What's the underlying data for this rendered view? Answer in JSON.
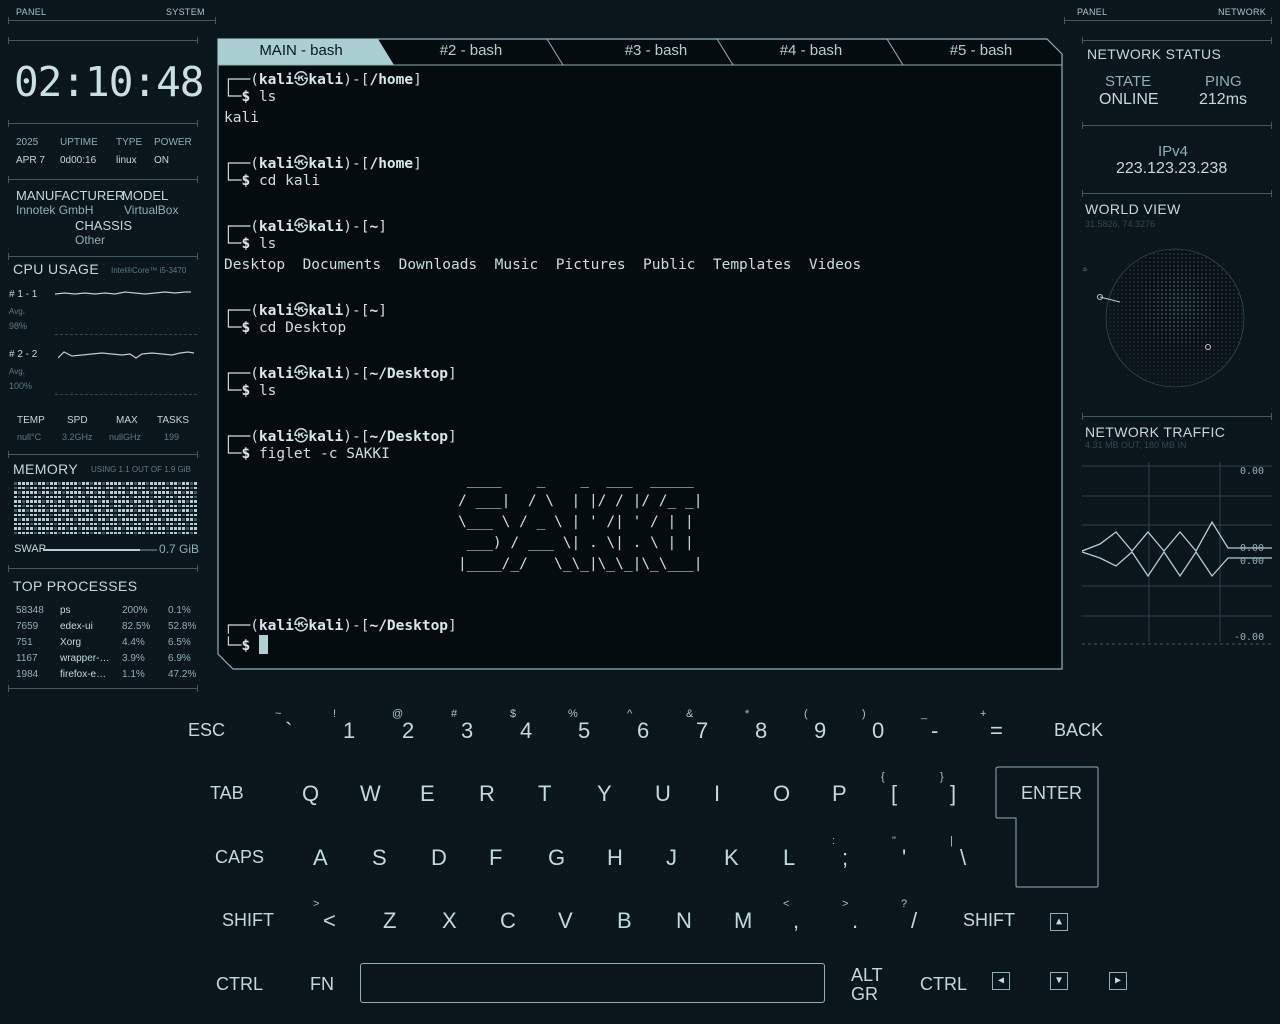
{
  "left_panel": {
    "header_left": "PANEL",
    "header_right": "SYSTEM",
    "clock": "02:10:48",
    "info_labels": [
      "2025",
      "UPTIME",
      "TYPE",
      "POWER"
    ],
    "info_values": [
      "APR 7",
      "0d00:16",
      "linux",
      "ON"
    ],
    "hw_labels": [
      "MANUFACTURER",
      "MODEL"
    ],
    "hw_values": [
      "Innotek GmbH",
      "VirtualBox"
    ],
    "chassis_label": "CHASSIS",
    "chassis_value": "Other",
    "cpu_title": "CPU USAGE",
    "cpu_model": "Intel®Core™ i5-3470",
    "cpu_groups": [
      {
        "label": "# 1 - 1",
        "avg_label": "Avg.",
        "avg": "98%"
      },
      {
        "label": "# 2 - 2",
        "avg_label": "Avg.",
        "avg": "100%"
      }
    ],
    "stats_labels": [
      "TEMP",
      "SPD",
      "MAX",
      "TASKS"
    ],
    "stats_values": [
      "null°C",
      "3.2GHz",
      "nullGHz",
      "199"
    ],
    "memory_title": "MEMORY",
    "memory_usage": "USING 1.1 OUT OF 1.9 GiB",
    "swap_label": "SWAP",
    "swap_value": "0.7 GiB",
    "swap_fraction": 0.85,
    "processes_title": "TOP PROCESSES",
    "processes": [
      {
        "pid": "58348",
        "name": "ps",
        "cpu": "200%",
        "mem": "0.1%"
      },
      {
        "pid": "7659",
        "name": "edex-ui",
        "cpu": "82.5%",
        "mem": "52.8%"
      },
      {
        "pid": "751",
        "name": "Xorg",
        "cpu": "4.4%",
        "mem": "6.5%"
      },
      {
        "pid": "1167",
        "name": "wrapper-…",
        "cpu": "3.9%",
        "mem": "6.9%"
      },
      {
        "pid": "1984",
        "name": "firefox-e…",
        "cpu": "1.1%",
        "mem": "47.2%"
      }
    ]
  },
  "terminal": {
    "tabs": [
      "MAIN - bash",
      "#2 - bash",
      "#3 - bash",
      "#4 - bash",
      "#5 - bash"
    ],
    "lines": [
      {
        "kind": "prompt",
        "user": "kali",
        "host": "kali",
        "dir": "/home"
      },
      {
        "kind": "cmd",
        "text": "ls"
      },
      {
        "kind": "out",
        "text": "kali"
      },
      {
        "kind": "prompt",
        "user": "kali",
        "host": "kali",
        "dir": "/home"
      },
      {
        "kind": "cmd",
        "text": "cd kali"
      },
      {
        "kind": "prompt",
        "user": "kali",
        "host": "kali",
        "dir": "~"
      },
      {
        "kind": "cmd",
        "text": "ls"
      },
      {
        "kind": "out",
        "text": "Desktop  Documents  Downloads  Music  Pictures  Public  Templates  Videos"
      },
      {
        "kind": "prompt",
        "user": "kali",
        "host": "kali",
        "dir": "~"
      },
      {
        "kind": "cmd",
        "text": "cd Desktop"
      },
      {
        "kind": "prompt",
        "user": "kali",
        "host": "kali",
        "dir": "~/Desktop"
      },
      {
        "kind": "cmd",
        "text": "ls"
      },
      {
        "kind": "prompt",
        "user": "kali",
        "host": "kali",
        "dir": "~/Desktop"
      },
      {
        "kind": "cmd",
        "text": "figlet -c SAKKI"
      },
      {
        "kind": "prompt",
        "user": "kali",
        "host": "kali",
        "dir": "~/Desktop"
      },
      {
        "kind": "cmd",
        "text": ""
      }
    ],
    "figlet": " ____    _    _  ___  _____\n/ ___|  / \\  | |/ / |/ /_ _|\n\\___ \\ / _ \\ | ' /| ' / | |\n ___) / ___ \\| . \\| . \\ | |\n|____/_/   \\_\\_|\\_\\_|\\_\\___|"
  },
  "right_panel": {
    "header_left": "PANEL",
    "header_right": "NETWORK",
    "status_title": "NETWORK STATUS",
    "state_label": "STATE",
    "state_value": "ONLINE",
    "ping_label": "PING",
    "ping_value": "212ms",
    "ip_label": "IPv4",
    "ip_value": "223.123.23.238",
    "world_title": "WORLD VIEW",
    "world_coords": "31.5826, 74.3276",
    "traffic_title": "NETWORK TRAFFIC",
    "traffic_sub": "4.31 MB OUT, 180 MB IN",
    "traffic_top": "0.00",
    "traffic_mid1": "0.00",
    "traffic_mid2": "0.00",
    "traffic_bottom": "-0.00"
  },
  "keyboard": {
    "row1": [
      {
        "name": "key-esc",
        "label": "ESC"
      },
      {
        "name": "key-backtick",
        "label": "`",
        "alt": "~"
      },
      {
        "name": "key-1",
        "label": "1",
        "alt": "!"
      },
      {
        "name": "key-2",
        "label": "2",
        "alt": "@"
      },
      {
        "name": "key-3",
        "label": "3",
        "alt": "#"
      },
      {
        "name": "key-4",
        "label": "4",
        "alt": "$"
      },
      {
        "name": "key-5",
        "label": "5",
        "alt": "%"
      },
      {
        "name": "key-6",
        "label": "6",
        "alt": "^"
      },
      {
        "name": "key-7",
        "label": "7",
        "alt": "&"
      },
      {
        "name": "key-8",
        "label": "8",
        "alt": "*"
      },
      {
        "name": "key-9",
        "label": "9",
        "alt": "("
      },
      {
        "name": "key-0",
        "label": "0",
        "alt": ")"
      },
      {
        "name": "key-minus",
        "label": "-",
        "alt": "_"
      },
      {
        "name": "key-equal",
        "label": "=",
        "alt": "+"
      },
      {
        "name": "key-back",
        "label": "BACK"
      }
    ],
    "row2": [
      {
        "name": "key-tab",
        "label": "TAB"
      },
      {
        "name": "key-q",
        "label": "Q"
      },
      {
        "name": "key-w",
        "label": "W"
      },
      {
        "name": "key-e",
        "label": "E"
      },
      {
        "name": "key-r",
        "label": "R"
      },
      {
        "name": "key-t",
        "label": "T"
      },
      {
        "name": "key-y",
        "label": "Y"
      },
      {
        "name": "key-u",
        "label": "U"
      },
      {
        "name": "key-i",
        "label": "I"
      },
      {
        "name": "key-o",
        "label": "O"
      },
      {
        "name": "key-p",
        "label": "P"
      },
      {
        "name": "key-lbracket",
        "label": "[",
        "alt": "{"
      },
      {
        "name": "key-rbracket",
        "label": "]",
        "alt": "}"
      },
      {
        "name": "key-enter",
        "label": "ENTER"
      }
    ],
    "row3": [
      {
        "name": "key-caps",
        "label": "CAPS"
      },
      {
        "name": "key-a",
        "label": "A"
      },
      {
        "name": "key-s",
        "label": "S"
      },
      {
        "name": "key-d",
        "label": "D"
      },
      {
        "name": "key-f",
        "label": "F"
      },
      {
        "name": "key-g",
        "label": "G"
      },
      {
        "name": "key-h",
        "label": "H"
      },
      {
        "name": "key-j",
        "label": "J"
      },
      {
        "name": "key-k",
        "label": "K"
      },
      {
        "name": "key-l",
        "label": "L"
      },
      {
        "name": "key-semicolon",
        "label": ";",
        "alt": ":"
      },
      {
        "name": "key-quote",
        "label": "'",
        "alt": "\""
      },
      {
        "name": "key-backslash",
        "label": "\\",
        "alt": "|"
      }
    ],
    "row4": [
      {
        "name": "key-shift-left",
        "label": "SHIFT"
      },
      {
        "name": "key-lt",
        "label": "<",
        "alt": ">"
      },
      {
        "name": "key-z",
        "label": "Z"
      },
      {
        "name": "key-x",
        "label": "X"
      },
      {
        "name": "key-c",
        "label": "C"
      },
      {
        "name": "key-v",
        "label": "V"
      },
      {
        "name": "key-b",
        "label": "B"
      },
      {
        "name": "key-n",
        "label": "N"
      },
      {
        "name": "key-m",
        "label": "M"
      },
      {
        "name": "key-comma",
        "label": ",",
        "alt": "<"
      },
      {
        "name": "key-period",
        "label": ".",
        "alt": ">"
      },
      {
        "name": "key-slash",
        "label": "/",
        "alt": "?"
      },
      {
        "name": "key-shift-right",
        "label": "SHIFT"
      }
    ],
    "row5": [
      {
        "name": "key-ctrl-left",
        "label": "CTRL"
      },
      {
        "name": "key-fn",
        "label": "FN"
      },
      {
        "name": "key-altgr-1",
        "label": "ALT"
      },
      {
        "name": "key-altgr-2",
        "label": "GR"
      },
      {
        "name": "key-ctrl-right",
        "label": "CTRL"
      }
    ],
    "arrows": {
      "up": "▲",
      "left": "◀",
      "down": "▼",
      "right": "▶"
    }
  },
  "colors": {
    "accent": "#b4cfd3",
    "background": "#0b151c",
    "tab_active": "#aacfd2"
  }
}
